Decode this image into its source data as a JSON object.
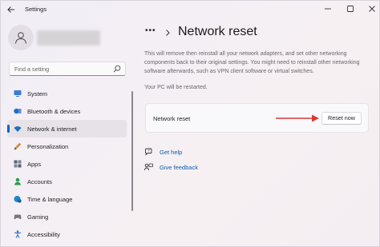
{
  "window": {
    "title": "Settings"
  },
  "sidebar": {
    "search_placeholder": "Find a setting",
    "items": [
      {
        "label": "System",
        "icon": "monitor-icon",
        "color": "#3a7bd5"
      },
      {
        "label": "Bluetooth & devices",
        "icon": "bluetooth-icon",
        "color": "#1f6fc4"
      },
      {
        "label": "Network & internet",
        "icon": "wifi-icon",
        "color": "#1f6fc4",
        "active": true
      },
      {
        "label": "Personalization",
        "icon": "brush-icon",
        "color": "#c8842e"
      },
      {
        "label": "Apps",
        "icon": "apps-icon",
        "color": "#556070"
      },
      {
        "label": "Accounts",
        "icon": "person-icon",
        "color": "#2e9a58"
      },
      {
        "label": "Time & language",
        "icon": "globe-clock-icon",
        "color": "#1f86c9"
      },
      {
        "label": "Gaming",
        "icon": "gamepad-icon",
        "color": "#777777"
      },
      {
        "label": "Accessibility",
        "icon": "accessibility-icon",
        "color": "#2a6fc2"
      }
    ]
  },
  "main": {
    "breadcrumb_more": "•••",
    "title": "Network reset",
    "description": "This will remove then reinstall all your network adapters, and set other networking components back to their original settings. You might need to reinstall other networking software afterwards, such as VPN client software or virtual switches.",
    "restart_note": "Your PC will be restarted.",
    "card": {
      "label": "Network reset",
      "button_label": "Reset now"
    },
    "links": [
      {
        "label": "Get help",
        "icon": "help-icon"
      },
      {
        "label": "Give feedback",
        "icon": "feedback-icon"
      }
    ]
  },
  "colors": {
    "accent": "#0067c0",
    "annotation_arrow": "#d63a3a",
    "link": "#0b5cad"
  }
}
